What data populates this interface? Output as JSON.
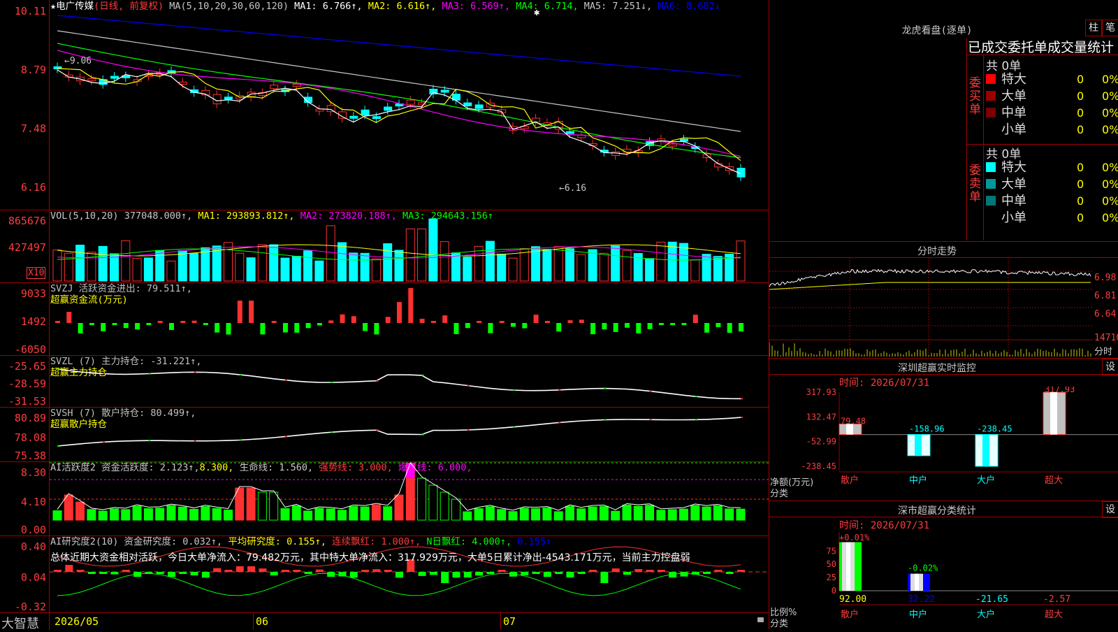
{
  "main": {
    "stock_title": "电广传媒",
    "period": "(日线, 前复权)",
    "ma_label": "MA(5,10,20,30,60,120)",
    "ma_items": [
      {
        "text": "MA1: 6.766↑,",
        "color": "#ffffff"
      },
      {
        "text": "MA2: 6.616↑,",
        "color": "#ffff00"
      },
      {
        "text": "MA3: 6.569↑,",
        "color": "#ff00ff"
      },
      {
        "text": "MA4: 6.714,",
        "color": "#00ff00"
      },
      {
        "text": "MA5: 7.251↓,",
        "color": "#c8c8c8"
      },
      {
        "text": "MA6: 8.682↓",
        "color": "#0000ff"
      }
    ],
    "y_ticks": [
      "10.11",
      "8.79",
      "7.48",
      "6.16"
    ],
    "high_note": "←9.06",
    "low_note": "←6.16"
  },
  "vol": {
    "header": "VOL(5,10,20)",
    "items": [
      {
        "text": "377048.000↑,",
        "color": "#c8c8c8"
      },
      {
        "text": "MA1: 293893.812↑,",
        "color": "#ffff00"
      },
      {
        "text": "MA2: 273820.188↑,",
        "color": "#ff00ff"
      },
      {
        "text": "MA3: 294643.156↑",
        "color": "#00ff00"
      }
    ],
    "y_ticks": [
      "865676",
      "427497"
    ],
    "unit": "X10"
  },
  "svzj": {
    "header": "SVZJ",
    "line1": "活跃资金进出: 79.511↑,",
    "line2": "超赢资金流(万元)",
    "y_ticks": [
      "9033",
      "1492",
      "-6050"
    ]
  },
  "svzl": {
    "header": "SVZL (7) 主力持仓: -31.221↑,",
    "line2": "超赢主力持仓",
    "y_ticks": [
      "-25.65",
      "-28.59",
      "-31.53"
    ]
  },
  "svsh": {
    "header": "SVSH (7) 散户持仓: 80.499↑,",
    "line2": "超赢散户持仓",
    "y_ticks": [
      "80.89",
      "78.08",
      "75.38"
    ]
  },
  "ai1": {
    "items": [
      {
        "text": "AI活跃度2 资金活跃度: 2.123↑,",
        "color": "#c8c8c8"
      },
      {
        "text": "8.300,",
        "color": "#ffff00"
      },
      {
        "text": "生命线: 1.560,",
        "color": "#c8c8c8"
      },
      {
        "text": "强势线: 3.000,",
        "color": "#ff3c3c"
      },
      {
        "text": "爆发线: 6.000,",
        "color": "#ff00ff"
      }
    ],
    "y_ticks": [
      "8.30",
      "4.10",
      "0.00"
    ]
  },
  "ai2": {
    "items": [
      {
        "text": "AI研究度2(10) 资金研究度: 0.032↑,",
        "color": "#c8c8c8"
      },
      {
        "text": "平均研究度: 0.155↑,",
        "color": "#ffff00"
      },
      {
        "text": "连续飘红: 1.000↑,",
        "color": "#ff3c3c"
      },
      {
        "text": "N日飘红: 4.000↑,",
        "color": "#00ff00"
      },
      {
        "text": "0.155↑",
        "color": "#0000ff"
      }
    ],
    "summary": "总体近期大资金相对活跃，今日大单净流入：79.482万元，其中特大单净流入：317.929万元，大单5日累计净出-4543.171万元，当前主力控盘弱",
    "y_ticks": [
      "0.40",
      "0.04",
      "-0.32"
    ]
  },
  "bottom": {
    "brand": "大智慧",
    "dates": [
      "2026/05",
      "06",
      "07"
    ]
  },
  "longhu": {
    "title": "龙虎看盘(逐单)",
    "btn_column": "柱",
    "btn_pen": "笔",
    "subtitle": "已成交委托单成交量统计",
    "buy_label": "委买单",
    "sell_label": "委卖单",
    "buy_total": "共 0单",
    "sell_total": "共 0单",
    "buy_rows": [
      {
        "name": "特大",
        "count": "0",
        "pct": "0%",
        "color": "#ff0000"
      },
      {
        "name": "大单",
        "count": "0",
        "pct": "0%",
        "color": "#990000"
      },
      {
        "name": "中单",
        "count": "0",
        "pct": "0%",
        "color": "#770000"
      },
      {
        "name": "小单",
        "count": "0",
        "pct": "0%",
        "color": "#000000"
      }
    ],
    "sell_rows": [
      {
        "name": "特大",
        "count": "0",
        "pct": "0%",
        "color": "#00ffff"
      },
      {
        "name": "大单",
        "count": "0",
        "pct": "0%",
        "color": "#009999"
      },
      {
        "name": "中单",
        "count": "0",
        "pct": "0%",
        "color": "#007777"
      },
      {
        "name": "小单",
        "count": "0",
        "pct": "0%",
        "color": "#000000"
      }
    ]
  },
  "intraday": {
    "title": "分时走势",
    "y_ticks": [
      "6.98",
      "6.81",
      "6.64"
    ],
    "vol_label": "14710",
    "vol_unit": "分时"
  },
  "sz_monitor": {
    "title": "深圳超赢实时监控",
    "btn": "设",
    "time": "时间: 2026/07/31",
    "y_ticks": [
      "317.93",
      "132.47",
      "-52.99",
      "-238.45"
    ],
    "y_label": "净额(万元)",
    "x_label": "分类",
    "categories": [
      "散户",
      "中户",
      "大户",
      "超大"
    ],
    "chart_data": {
      "type": "bar",
      "categories": [
        "散户",
        "中户",
        "大户",
        "超大"
      ],
      "values": [
        79.48,
        -158.96,
        -238.45,
        317.93
      ],
      "ylabel": "净额(万元)",
      "ylim": [
        -238.45,
        317.93
      ]
    },
    "value_labels": [
      "79.48",
      "-158.96",
      "-238.45",
      "317.93"
    ]
  },
  "sz_class": {
    "title": "深市超赢分类统计",
    "btn": "设",
    "time": "时间: 2026/07/31",
    "y_ticks": [
      "75",
      "50",
      "25",
      "0"
    ],
    "y_label": "比例%",
    "x_label": "分类",
    "categories": [
      "散户",
      "中户",
      "大户",
      "超大"
    ],
    "bar_labels": [
      "+0.01%",
      "-0.02%"
    ],
    "values": [
      "92.00",
      "32.22",
      "-21.65",
      "-2.57"
    ],
    "chart_data": {
      "type": "bar",
      "categories": [
        "散户",
        "中户",
        "大户",
        "超大"
      ],
      "values": [
        92.0,
        32.22,
        -21.65,
        -2.57
      ],
      "ylabel": "比例%"
    }
  }
}
